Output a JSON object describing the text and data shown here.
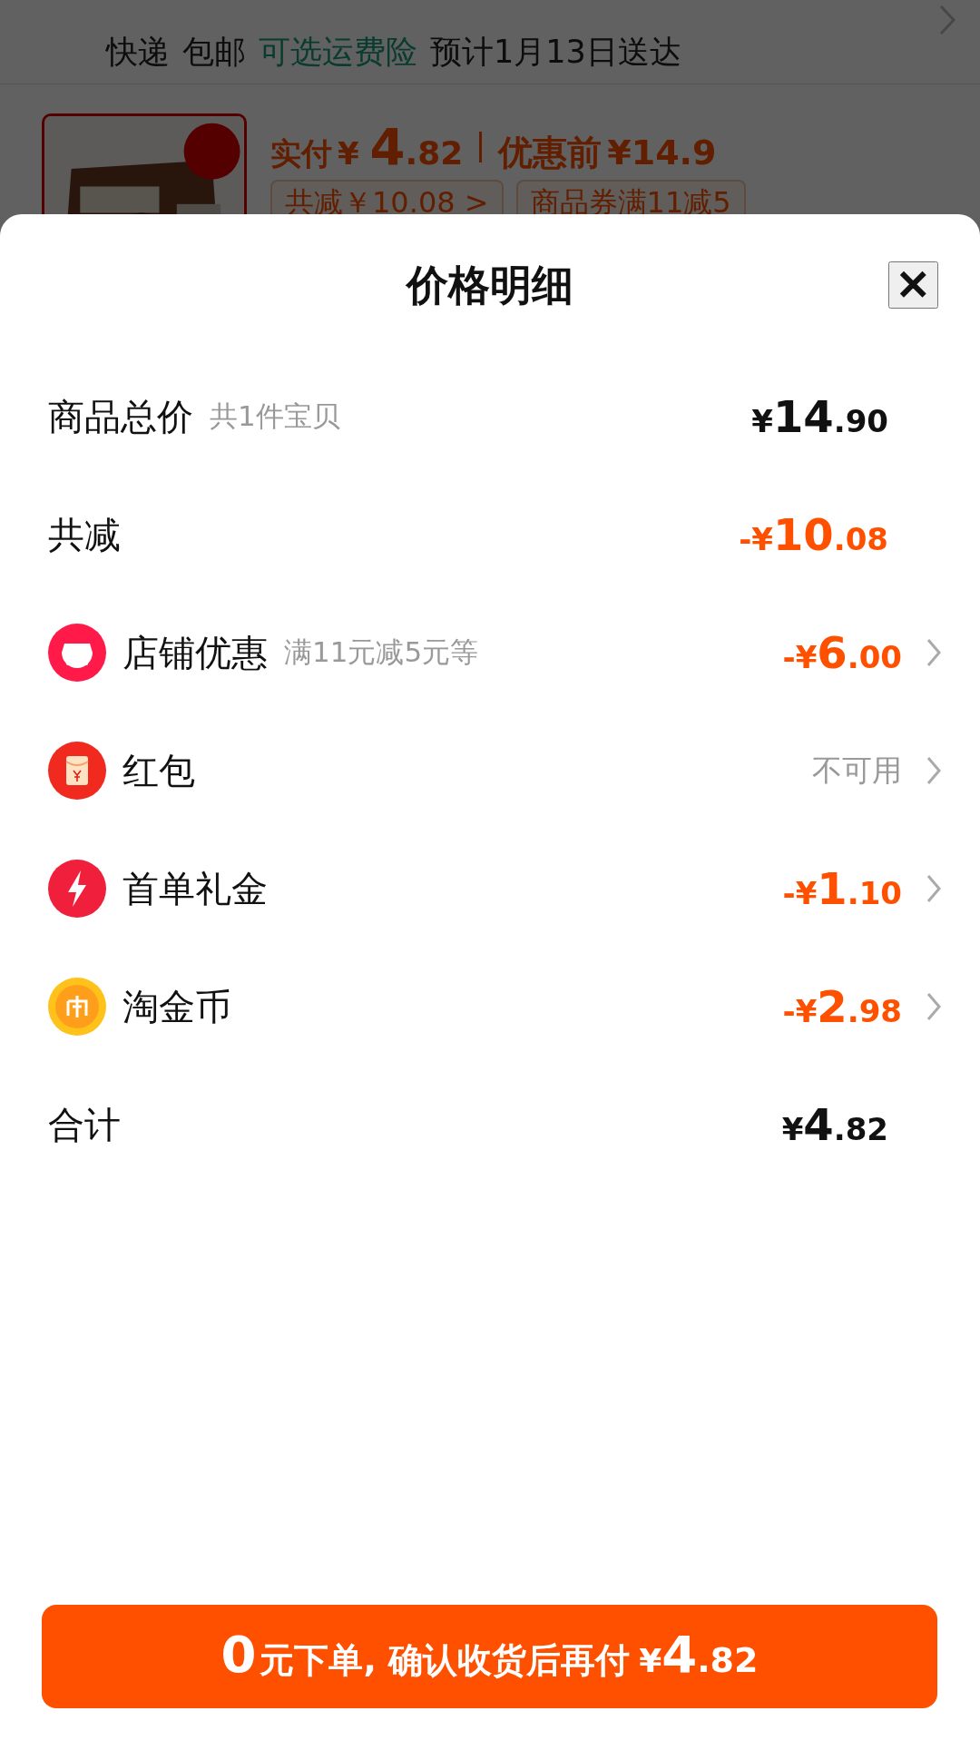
{
  "background": {
    "delivery": [
      {
        "text": "快递",
        "kind": "plain"
      },
      {
        "text": "包邮",
        "kind": "plain"
      },
      {
        "text": "可选运费险",
        "kind": "link"
      },
      {
        "text": "预计1月13日送达",
        "kind": "plain"
      }
    ],
    "product": {
      "paid_label": "实付",
      "paid": {
        "prefix": "¥",
        "main": "4",
        "fraction": ".82"
      },
      "before_label": "优惠前",
      "before": "¥14.9",
      "tags": [
        "共减￥10.08 >",
        "商品券满11减5"
      ]
    }
  },
  "sheet": {
    "title": "价格明细",
    "close": "✕",
    "rows": [
      {
        "kind": "total",
        "label": "商品总价",
        "note": "共1件宝贝",
        "amount": {
          "prefix": "¥",
          "main": "14",
          "fraction": ".90"
        },
        "highlight": false,
        "chevron": false
      },
      {
        "kind": "total",
        "label": "共减",
        "amount": {
          "prefix": "-¥",
          "main": "10",
          "fraction": ".08"
        },
        "highlight": true,
        "chevron": false
      },
      {
        "kind": "shop",
        "label": "店铺优惠",
        "note": "满11元减5元等",
        "amount": {
          "prefix": "-¥",
          "main": "6",
          "fraction": ".00"
        },
        "highlight": true,
        "chevron": true
      },
      {
        "kind": "packet",
        "label": "红包",
        "status": "不可用",
        "chevron": true
      },
      {
        "kind": "bolt",
        "label": "首单礼金",
        "amount": {
          "prefix": "-¥",
          "main": "1",
          "fraction": ".10"
        },
        "highlight": true,
        "chevron": true
      },
      {
        "kind": "coin",
        "label": "淘金币",
        "amount": {
          "prefix": "-¥",
          "main": "2",
          "fraction": ".98"
        },
        "highlight": true,
        "chevron": true
      },
      {
        "kind": "total",
        "label": "合计",
        "amount": {
          "prefix": "¥",
          "main": "4",
          "fraction": ".82"
        },
        "highlight": false,
        "chevron": false
      }
    ],
    "button": {
      "lead": "0",
      "text": "元下单, 确认收货后再付",
      "currency": "¥",
      "main": "4",
      "fraction": ".82"
    }
  }
}
